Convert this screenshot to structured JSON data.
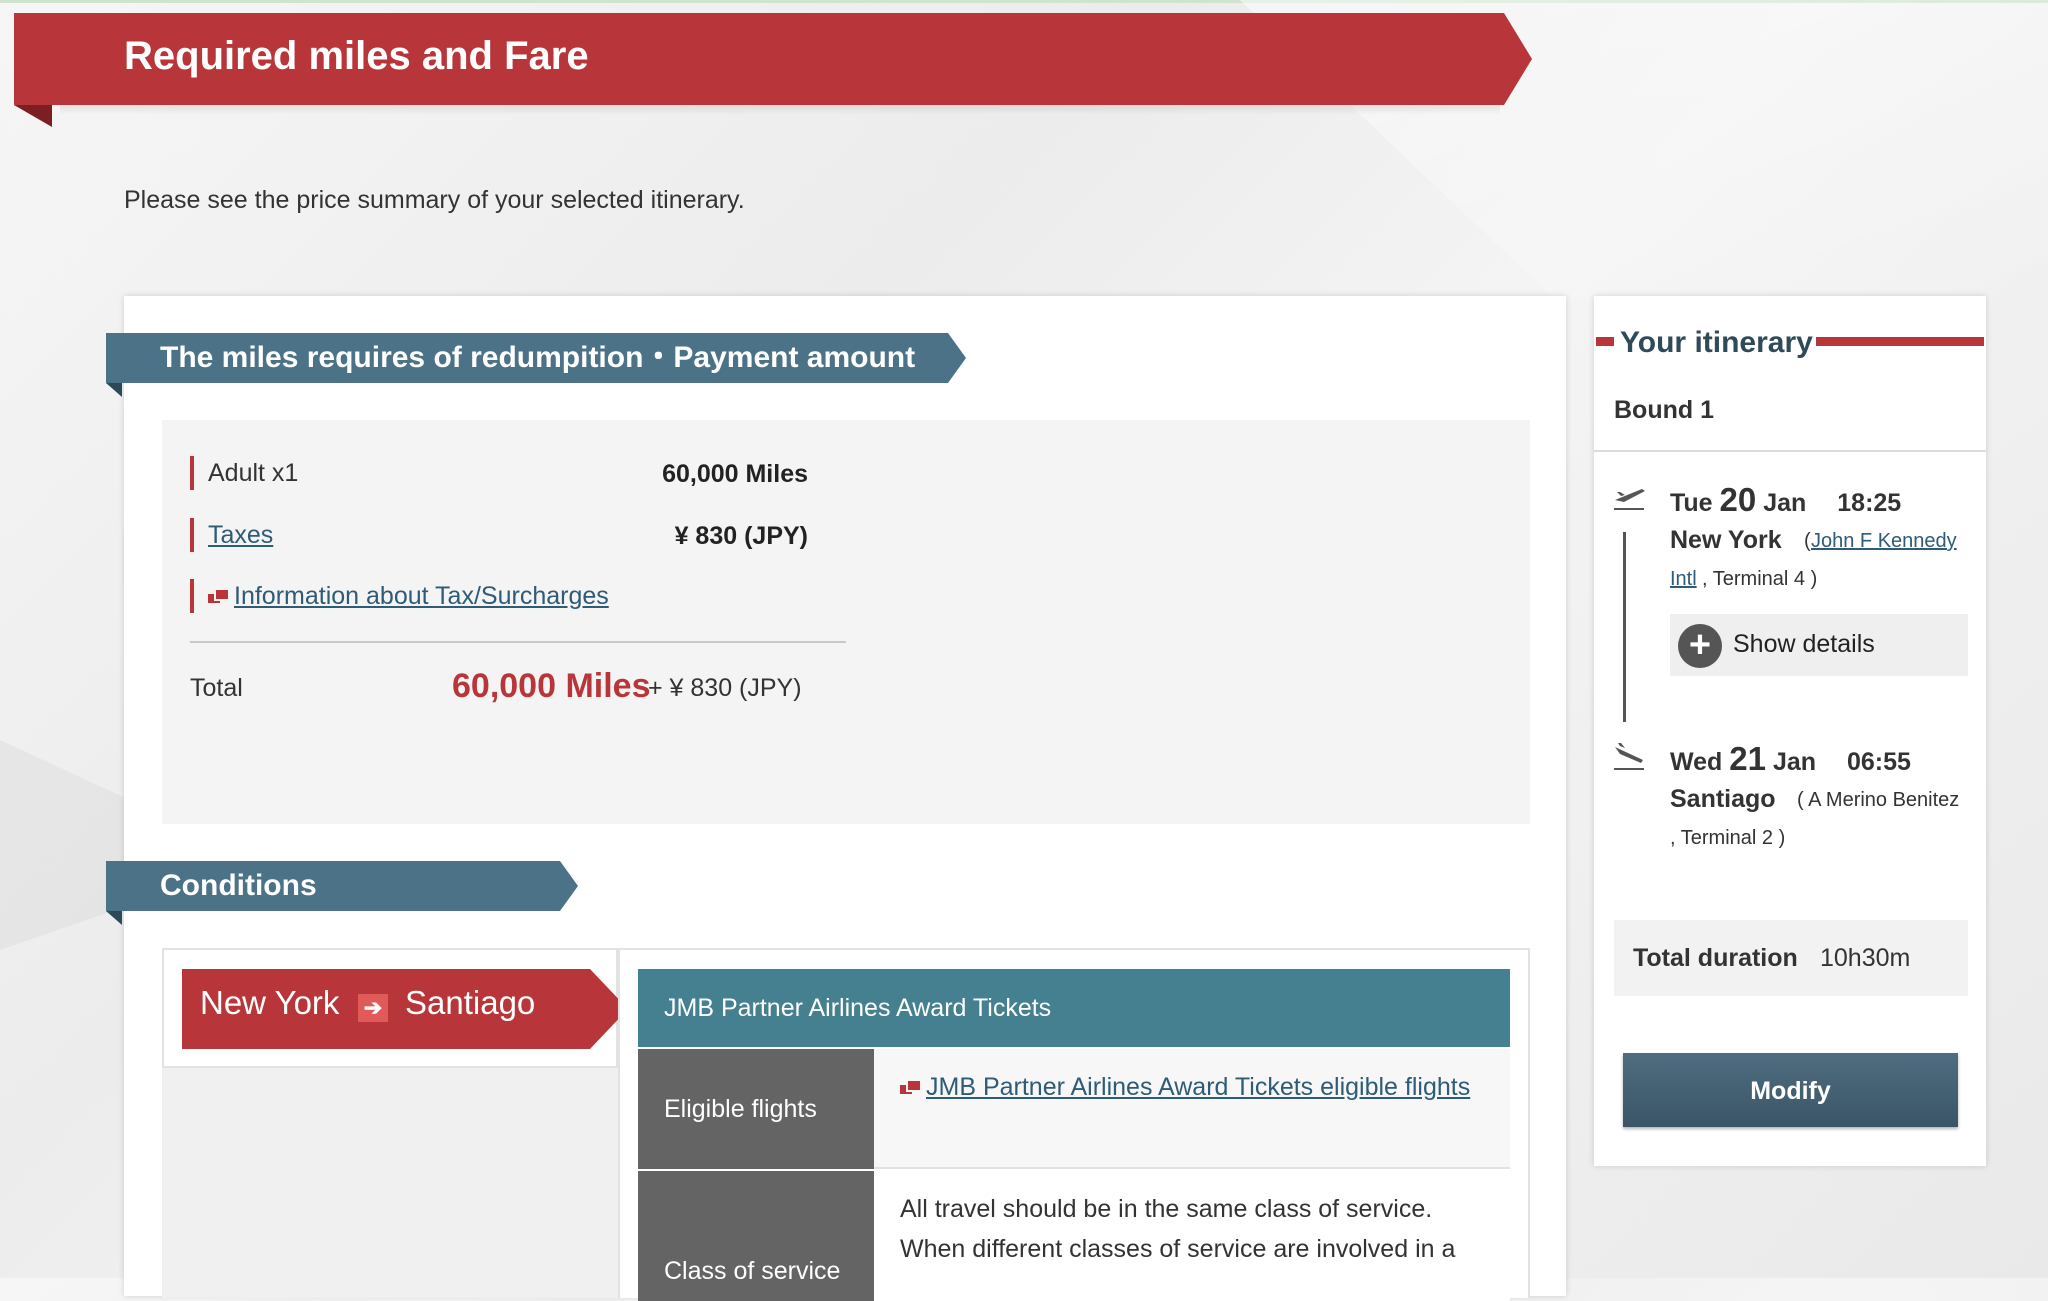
{
  "page": {
    "title": "Required miles and Fare",
    "intro": "Please see the price summary of your selected itinerary."
  },
  "payment": {
    "header": "The miles requires of redumpition・Payment amount",
    "rows": [
      {
        "label": "Adult x1",
        "value": "60,000 Miles"
      },
      {
        "label": "Taxes",
        "value": "¥ 830 (JPY)"
      }
    ],
    "info_link": "Information about Tax/Surcharges",
    "total_label": "Total",
    "total_miles": "60,000 Miles",
    "total_extra": "+ ¥ 830 (JPY)"
  },
  "conditions": {
    "header": "Conditions",
    "route_from": "New York",
    "route_to": "Santiago",
    "ticket_type": "JMB Partner Airlines Award Tickets",
    "eligible_label": "Eligible flights",
    "eligible_link": "JMB Partner Airlines Award Tickets eligible flights",
    "class_label": "Class of service",
    "class_text_1": "All travel should be in the same class of service.",
    "class_text_2": "When different classes of service are involved in a"
  },
  "itinerary": {
    "title": "Your itinerary",
    "bound": "Bound 1",
    "departure": {
      "dow": "Tue",
      "day": "20",
      "month": "Jan",
      "time": "18:25",
      "city": "New York",
      "open_paren": "(",
      "airport_a": "John F Kennedy",
      "airport_b": "Intl",
      "terminal": ",  Terminal 4 )"
    },
    "show_details": "Show details",
    "arrival": {
      "dow": "Wed",
      "day": "21",
      "month": "Jan",
      "time": "06:55",
      "city": "Santiago",
      "airport": "( A Merino Benitez",
      "terminal": ",  Terminal 2 )"
    },
    "duration_label": "Total duration",
    "duration_value": "10h30m",
    "modify": "Modify"
  }
}
